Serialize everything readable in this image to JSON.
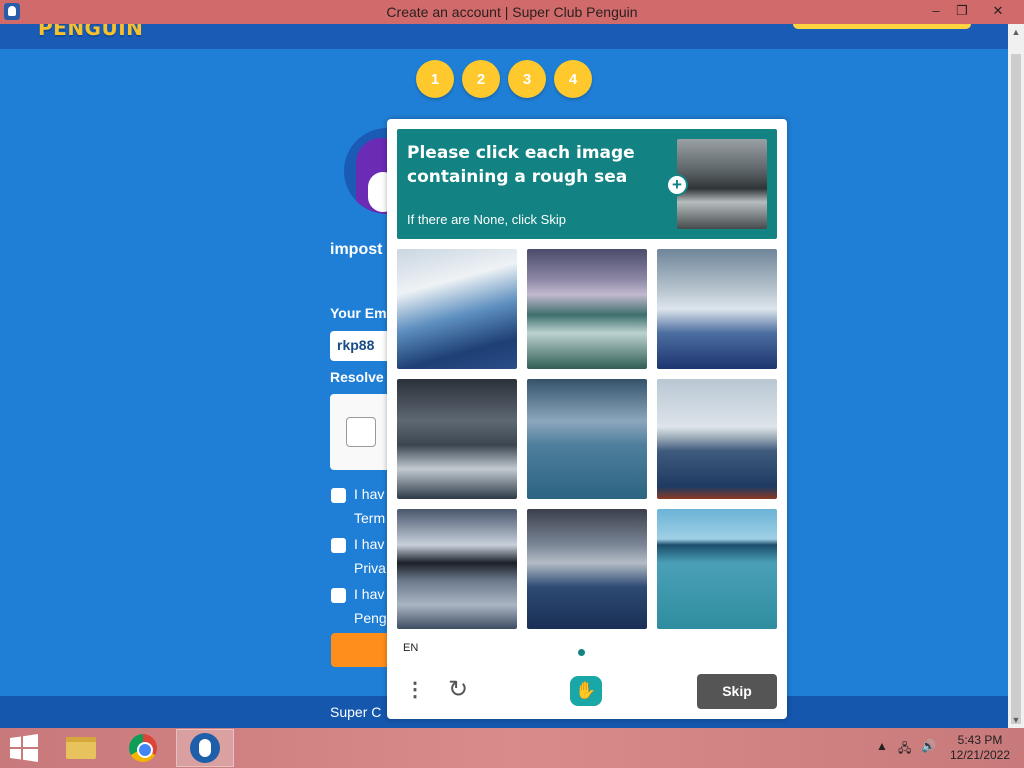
{
  "window": {
    "title": "Create an account | Super Club Penguin",
    "controls": {
      "minimize": "–",
      "restore": "❐",
      "close": "✕"
    }
  },
  "page": {
    "logo": "PENGUIN",
    "steps": [
      "1",
      "2",
      "3",
      "4"
    ],
    "username": "impost",
    "email_label": "Your Em",
    "email_value": "rkp88",
    "resolve_label": "Resolve",
    "agreements": [
      {
        "line1": "I hav",
        "line2": "Term"
      },
      {
        "line1": "I hav",
        "line2": "Priva"
      },
      {
        "line1": "I hav",
        "line2": "Peng"
      }
    ],
    "footer_text": "Super C"
  },
  "captcha": {
    "prompt": "Please click each image containing a rough sea",
    "subprompt": "If there are None, click Skip",
    "example_icon": "plus-icon",
    "language": "EN",
    "skip_label": "Skip",
    "accent_color": "#128283",
    "tiles": [
      {
        "name": "stormy-waves-image"
      },
      {
        "name": "lightning-sea-image"
      },
      {
        "name": "crashing-wave-image"
      },
      {
        "name": "dark-storm-sea-image"
      },
      {
        "name": "sailboat-calm-sea-image"
      },
      {
        "name": "calm-coast-image"
      },
      {
        "name": "calm-lake-image"
      },
      {
        "name": "storm-waves-lightning-image"
      },
      {
        "name": "calm-turquoise-sea-image"
      }
    ]
  },
  "taskbar": {
    "time": "5:43 PM",
    "date": "12/21/2022"
  }
}
